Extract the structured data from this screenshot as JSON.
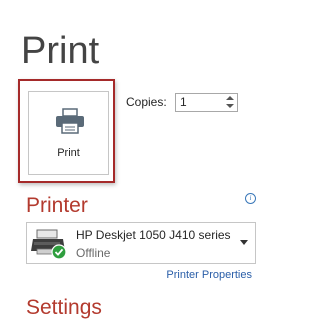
{
  "page": {
    "title": "Print"
  },
  "print_button": {
    "label": "Print",
    "icon": "printer-icon",
    "highlight_color": "#a52a2a"
  },
  "copies": {
    "label": "Copies:",
    "value": "1"
  },
  "printer_section": {
    "heading": "Printer",
    "info_icon": "info-icon",
    "selected_printer": {
      "name": "HP Deskjet 1050 J410 series",
      "status": "Offline"
    },
    "properties_link": "Printer Properties"
  },
  "settings_section": {
    "heading": "Settings"
  },
  "colors": {
    "heading": "#b33a2e",
    "link": "#2a5ea8",
    "offline_badge": "#2e9e3e"
  }
}
